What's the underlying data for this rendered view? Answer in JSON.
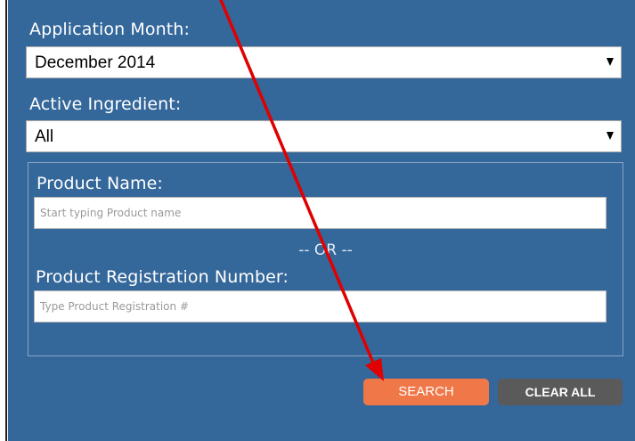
{
  "form": {
    "application_month": {
      "label": "Application Month:",
      "selected": "December 2014"
    },
    "active_ingredient": {
      "label": "Active Ingredient:",
      "selected": "All"
    },
    "product_name": {
      "label": "Product Name:",
      "placeholder": "Start typing Product name"
    },
    "separator": "-- OR --",
    "registration_number": {
      "label": "Product Registration Number:",
      "placeholder": "Type Product Registration #"
    },
    "buttons": {
      "search": "SEARCH",
      "clear_all": "CLEAR ALL"
    }
  },
  "colors": {
    "panel_background": "#34679a",
    "search_button": "#f07848",
    "clear_button": "#5a5a5a",
    "annotation_arrow": "#e00000"
  },
  "annotation": {
    "type": "arrow",
    "points_to": "search-button"
  }
}
